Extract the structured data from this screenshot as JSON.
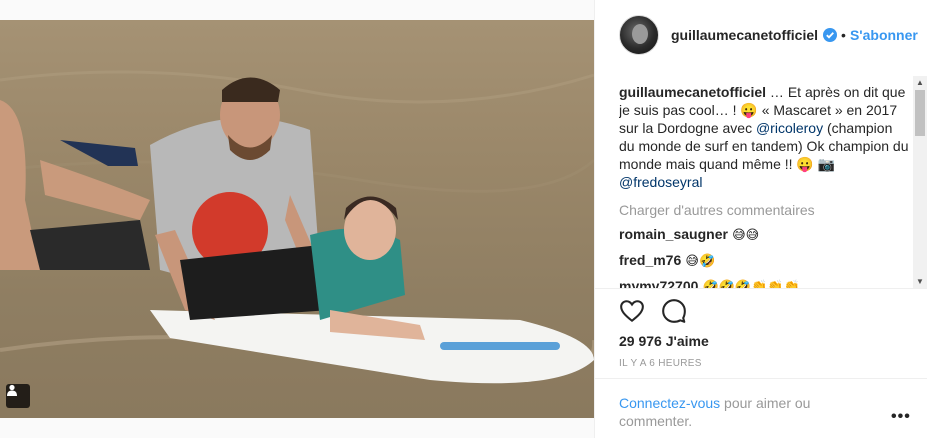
{
  "post": {
    "username": "guillaumecanetofficiel",
    "separator": "•",
    "follow_label": "S'abonner",
    "caption_text": " … Et après on dit que je suis pas cool… ! 😛 « Mascaret » en 2017 sur la Dordogne avec ",
    "caption_mention1": "@ricoleroy",
    "caption_text2": " (champion du monde de surf en tandem) Ok champion du monde mais quand même !! 😛 📷 ",
    "caption_mention2": "@fredoseyral",
    "load_more": "Charger d'autres commentaires",
    "comments": [
      {
        "user": "romain_saugner",
        "text": " 😅😅"
      },
      {
        "user": "fred_m76",
        "text": " 😅🤣"
      },
      {
        "user": "mymy72700",
        "text": " 🤣🤣🤣👏👏👏"
      }
    ],
    "likes": "29 976 J'aime",
    "time": "IL Y A 6 HEURES",
    "login_link": "Connectez-vous",
    "login_text": " pour aimer ou commenter.",
    "more_label": "•••"
  },
  "icons": {
    "like": "heart-icon",
    "comment": "comment-bubble-icon",
    "verified": "verified-badge-icon",
    "tag": "user-tag-icon"
  },
  "colors": {
    "link_blue": "#3897f0",
    "mention_blue": "#003569",
    "muted": "#999999"
  }
}
